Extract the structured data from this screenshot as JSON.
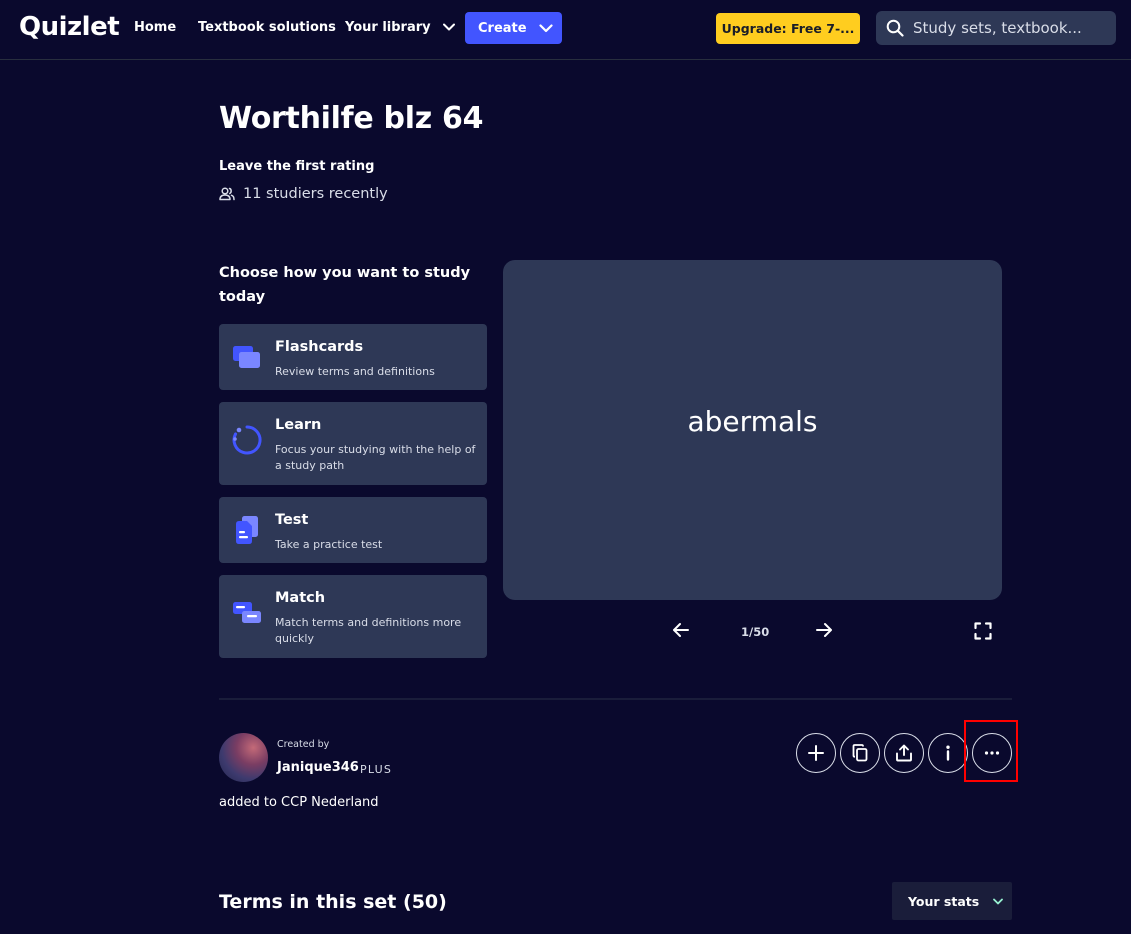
{
  "nav": {
    "logo": "Quizlet",
    "home": "Home",
    "textbook": "Textbook solutions",
    "library": "Your library",
    "create": "Create",
    "upgrade": "Upgrade: Free 7-...",
    "search_placeholder": "Study sets, textbook..."
  },
  "set": {
    "title": "Worthilfe blz 64",
    "rating": "Leave the first rating",
    "studiers": "11 studiers recently"
  },
  "study": {
    "heading": "Choose how you want to study today",
    "modes": [
      {
        "title": "Flashcards",
        "desc": "Review terms and definitions",
        "icon": "flashcards-icon"
      },
      {
        "title": "Learn",
        "desc": "Focus your studying with the help of a study path",
        "icon": "learn-icon"
      },
      {
        "title": "Test",
        "desc": "Take a practice test",
        "icon": "test-icon"
      },
      {
        "title": "Match",
        "desc": "Match terms and definitions more quickly",
        "icon": "match-icon"
      }
    ]
  },
  "card": {
    "term": "abermals",
    "counter": "1/50"
  },
  "creator": {
    "label": "Created by",
    "name": "Janique346",
    "badge": "PLUS",
    "added": "added to CCP Nederland"
  },
  "terms": {
    "title": "Terms in this set (50)",
    "stats": "Your stats"
  },
  "colors": {
    "background": "#0a092d",
    "surface": "#2e3856",
    "accent": "#4255ff",
    "upgrade": "#ffcd1f",
    "highlight": "#ff0000"
  }
}
